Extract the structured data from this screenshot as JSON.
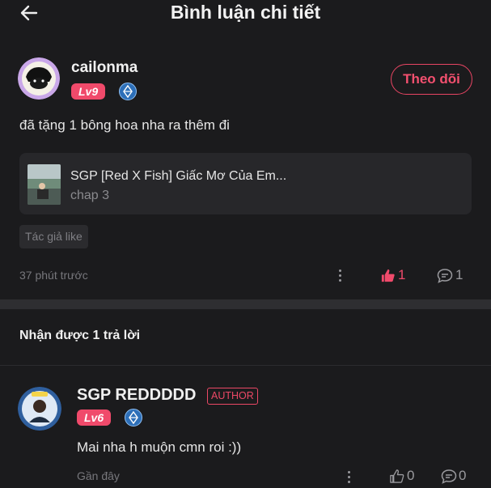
{
  "header": {
    "title": "Bình luận chi tiết"
  },
  "comment": {
    "username": "cailonma",
    "level": "Lv9",
    "follow_label": "Theo dõi",
    "text": "đã tặng 1 bông hoa nha ra thêm đi",
    "story": {
      "title": "SGP [Red X Fish] Giấc Mơ Của Em...",
      "chapter": "chap 3"
    },
    "author_like_label": "Tác giả like",
    "time": "37 phút trước",
    "likes": "1",
    "replies": "1"
  },
  "replies_section": {
    "heading": "Nhận được 1 trả lời",
    "items": [
      {
        "username": "SGP REDDDDD",
        "author_tag": "AUTHOR",
        "level": "Lv6",
        "text": "Mai nha h muộn cmn roi :))",
        "time": "Gần đây",
        "likes": "0",
        "replies": "0"
      }
    ]
  },
  "colors": {
    "accent": "#f04a6b",
    "background": "#1b1b1d",
    "card": "#27272a"
  }
}
